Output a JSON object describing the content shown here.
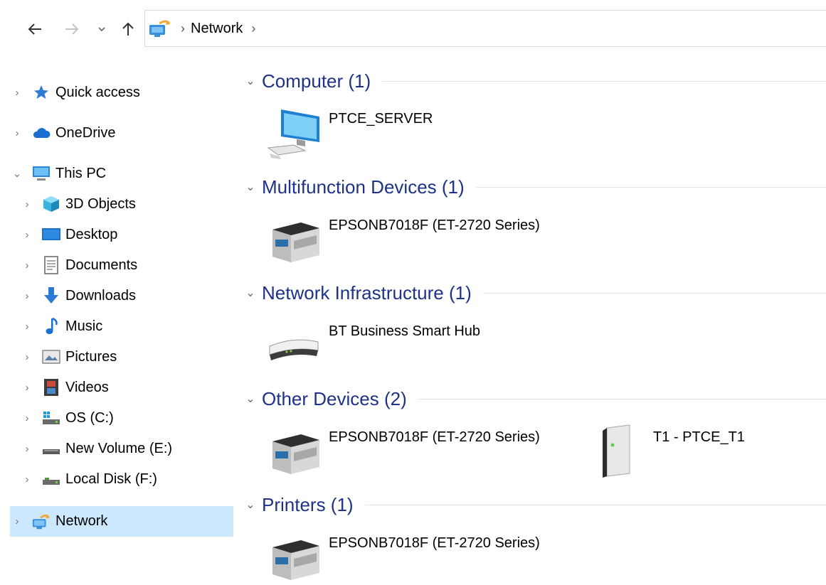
{
  "address": {
    "crumbs": [
      {
        "label": "Network"
      }
    ]
  },
  "sidebar": {
    "items": [
      {
        "label": "Quick access",
        "icon": "star-icon"
      },
      {
        "label": "OneDrive",
        "icon": "cloud-icon"
      },
      {
        "label": "This PC",
        "icon": "computer-icon"
      },
      {
        "label": "3D Objects",
        "icon": "cube-icon"
      },
      {
        "label": "Desktop",
        "icon": "desktop-icon"
      },
      {
        "label": "Documents",
        "icon": "document-icon"
      },
      {
        "label": "Downloads",
        "icon": "download-arrow-icon"
      },
      {
        "label": "Music",
        "icon": "music-note-icon"
      },
      {
        "label": "Pictures",
        "icon": "picture-icon"
      },
      {
        "label": "Videos",
        "icon": "video-icon"
      },
      {
        "label": "OS (C:)",
        "icon": "windows-drive-icon"
      },
      {
        "label": "New Volume (E:)",
        "icon": "drive-icon"
      },
      {
        "label": "Local Disk (F:)",
        "icon": "drive-icon"
      },
      {
        "label": "Network",
        "icon": "network-icon"
      }
    ]
  },
  "groups": [
    {
      "title": "Computer (1)",
      "devices": [
        {
          "name": "PTCE_SERVER",
          "icon": "computer-icon"
        }
      ]
    },
    {
      "title": "Multifunction Devices (1)",
      "devices": [
        {
          "name": "EPSONB7018F (ET-2720 Series)",
          "icon": "printer-icon"
        }
      ]
    },
    {
      "title": "Network Infrastructure (1)",
      "devices": [
        {
          "name": "BT Business Smart Hub",
          "icon": "router-icon"
        }
      ]
    },
    {
      "title": "Other Devices (2)",
      "devices": [
        {
          "name": "EPSONB7018F (ET-2720 Series)",
          "icon": "printer-icon"
        },
        {
          "name": "T1 - PTCE_T1",
          "icon": "server-tower-icon"
        }
      ]
    },
    {
      "title": "Printers (1)",
      "devices": [
        {
          "name": "EPSONB7018F (ET-2720 Series)",
          "icon": "printer-icon"
        }
      ]
    }
  ],
  "colors": {
    "accent_text": "#1e3287",
    "selection": "#cce8ff",
    "folder_blue": "#2d8ae0"
  }
}
